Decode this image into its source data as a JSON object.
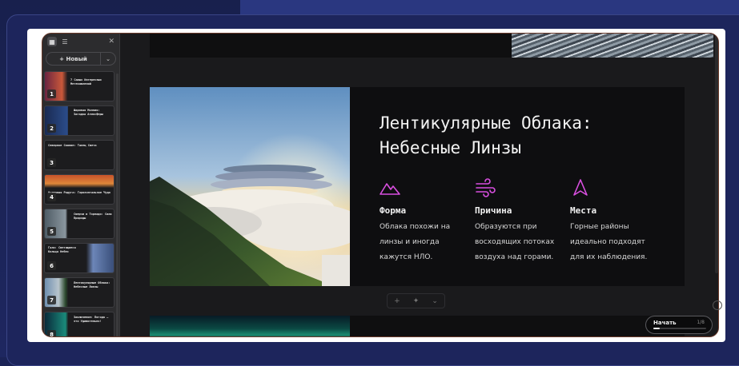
{
  "sidebar": {
    "new_label": "+ Новый",
    "thumbs": [
      {
        "num": "1",
        "title": "7 Самых Интересных Метеоявлений"
      },
      {
        "num": "2",
        "title": "Шаровая Молния: Загадка Атмосферы"
      },
      {
        "num": "3",
        "title": "Северное Сияние: Танец Света"
      },
      {
        "num": "4",
        "title": "Огненная Радуга: Горизонтальное Чудо"
      },
      {
        "num": "5",
        "title": "Смерчи и Торнадо: Сила Природы"
      },
      {
        "num": "6",
        "title": "Гало: Светящиеся Кольца Небес"
      },
      {
        "num": "7",
        "title": "Лентикулярные Облака: Небесные Линзы"
      },
      {
        "num": "8",
        "title": "Заключение: Погода — это Удивительно!"
      }
    ]
  },
  "slide": {
    "title_line1": "Лентикулярные Облака:",
    "title_line2": "Небесные Линзы",
    "columns": [
      {
        "icon": "mountain-icon",
        "heading": "Форма",
        "lines": [
          "Облака похожи на",
          "линзы и иногда",
          "кажутся НЛО."
        ]
      },
      {
        "icon": "wind-icon",
        "heading": "Причина",
        "lines": [
          "Образуются при",
          "восходящих потоках",
          "воздуха над горами."
        ]
      },
      {
        "icon": "navigation-arrow-icon",
        "heading": "Места",
        "lines": [
          "Горные районы",
          "идеально подходят",
          "для их наблюдения."
        ]
      }
    ],
    "accent_color": "#d94fe0"
  },
  "toolbar": {
    "add": "+",
    "ai": "✦",
    "more": "⌄"
  },
  "presenter": {
    "start_label": "Начать",
    "counter": "1/8",
    "progress": 0.125
  }
}
